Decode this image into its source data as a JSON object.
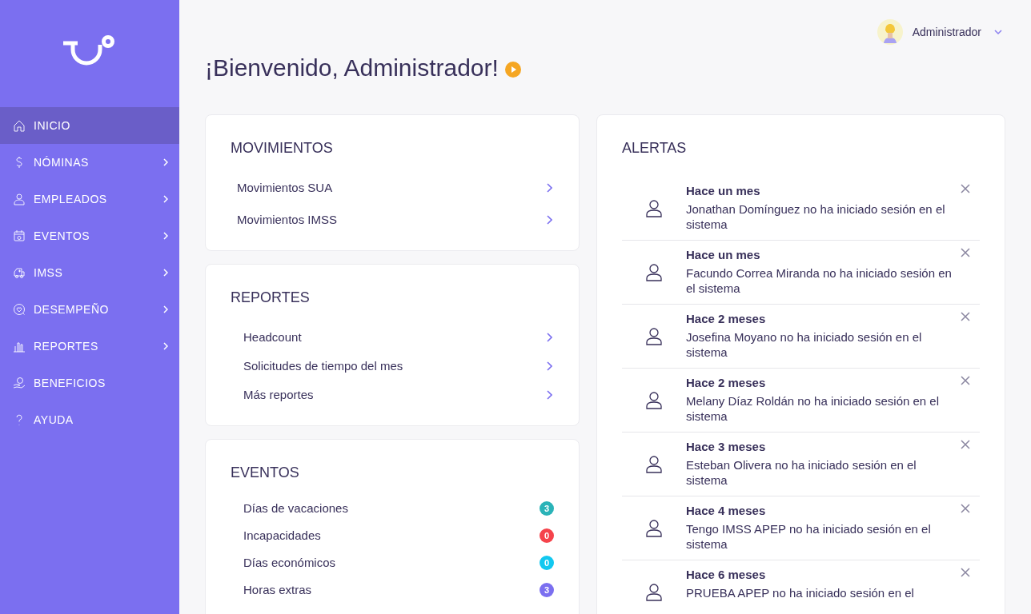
{
  "sidebar": {
    "items": [
      {
        "label": "INICIO",
        "selected": true,
        "expandable": false
      },
      {
        "label": "NÓMINAS",
        "selected": false,
        "expandable": true
      },
      {
        "label": "EMPLEADOS",
        "selected": false,
        "expandable": true
      },
      {
        "label": "EVENTOS",
        "selected": false,
        "expandable": true
      },
      {
        "label": "IMSS",
        "selected": false,
        "expandable": true
      },
      {
        "label": "DESEMPEÑO",
        "selected": false,
        "expandable": true
      },
      {
        "label": "REPORTES",
        "selected": false,
        "expandable": true
      },
      {
        "label": "BENEFICIOS",
        "selected": false,
        "expandable": false
      },
      {
        "label": "AYUDA",
        "selected": false,
        "expandable": false
      }
    ]
  },
  "user_menu": {
    "name": "Administrador"
  },
  "greeting": "¡Bienvenido, Administrador!",
  "movimientos": {
    "title": "MOVIMIENTOS",
    "items": [
      "Movimientos SUA",
      "Movimientos IMSS"
    ]
  },
  "reportes": {
    "title": "REPORTES",
    "items": [
      "Headcount",
      "Solicitudes de tiempo del mes",
      "Más reportes"
    ]
  },
  "eventos": {
    "title": "EVENTOS",
    "items": [
      {
        "label": "Días de vacaciones",
        "count": "3",
        "color": "#2ab3b8"
      },
      {
        "label": "Incapacidades",
        "count": "0",
        "color": "#f5434b"
      },
      {
        "label": "Días económicos",
        "count": "0",
        "color": "#12c8f0"
      },
      {
        "label": "Horas extras",
        "count": "3",
        "color": "#7b6ff0"
      }
    ]
  },
  "alertas": {
    "title": "ALERTAS",
    "items": [
      {
        "time": "Hace un mes",
        "message": "Jonathan Domínguez no ha iniciado sesión en el sistema"
      },
      {
        "time": "Hace un mes",
        "message": "Facundo Correa Miranda no ha iniciado sesión en el sistema"
      },
      {
        "time": "Hace 2 meses",
        "message": "Josefina Moyano no ha iniciado sesión en el sistema"
      },
      {
        "time": "Hace 2 meses",
        "message": "Melany Díaz Roldán no ha iniciado sesión en el sistema"
      },
      {
        "time": "Hace 3 meses",
        "message": "Esteban Olivera no ha iniciado sesión en el sistema"
      },
      {
        "time": "Hace 4 meses",
        "message": "Tengo IMSS APEP no ha iniciado sesión en el sistema"
      },
      {
        "time": "Hace 6 meses",
        "message": "PRUEBA APEP no ha iniciado sesión en el"
      }
    ]
  }
}
